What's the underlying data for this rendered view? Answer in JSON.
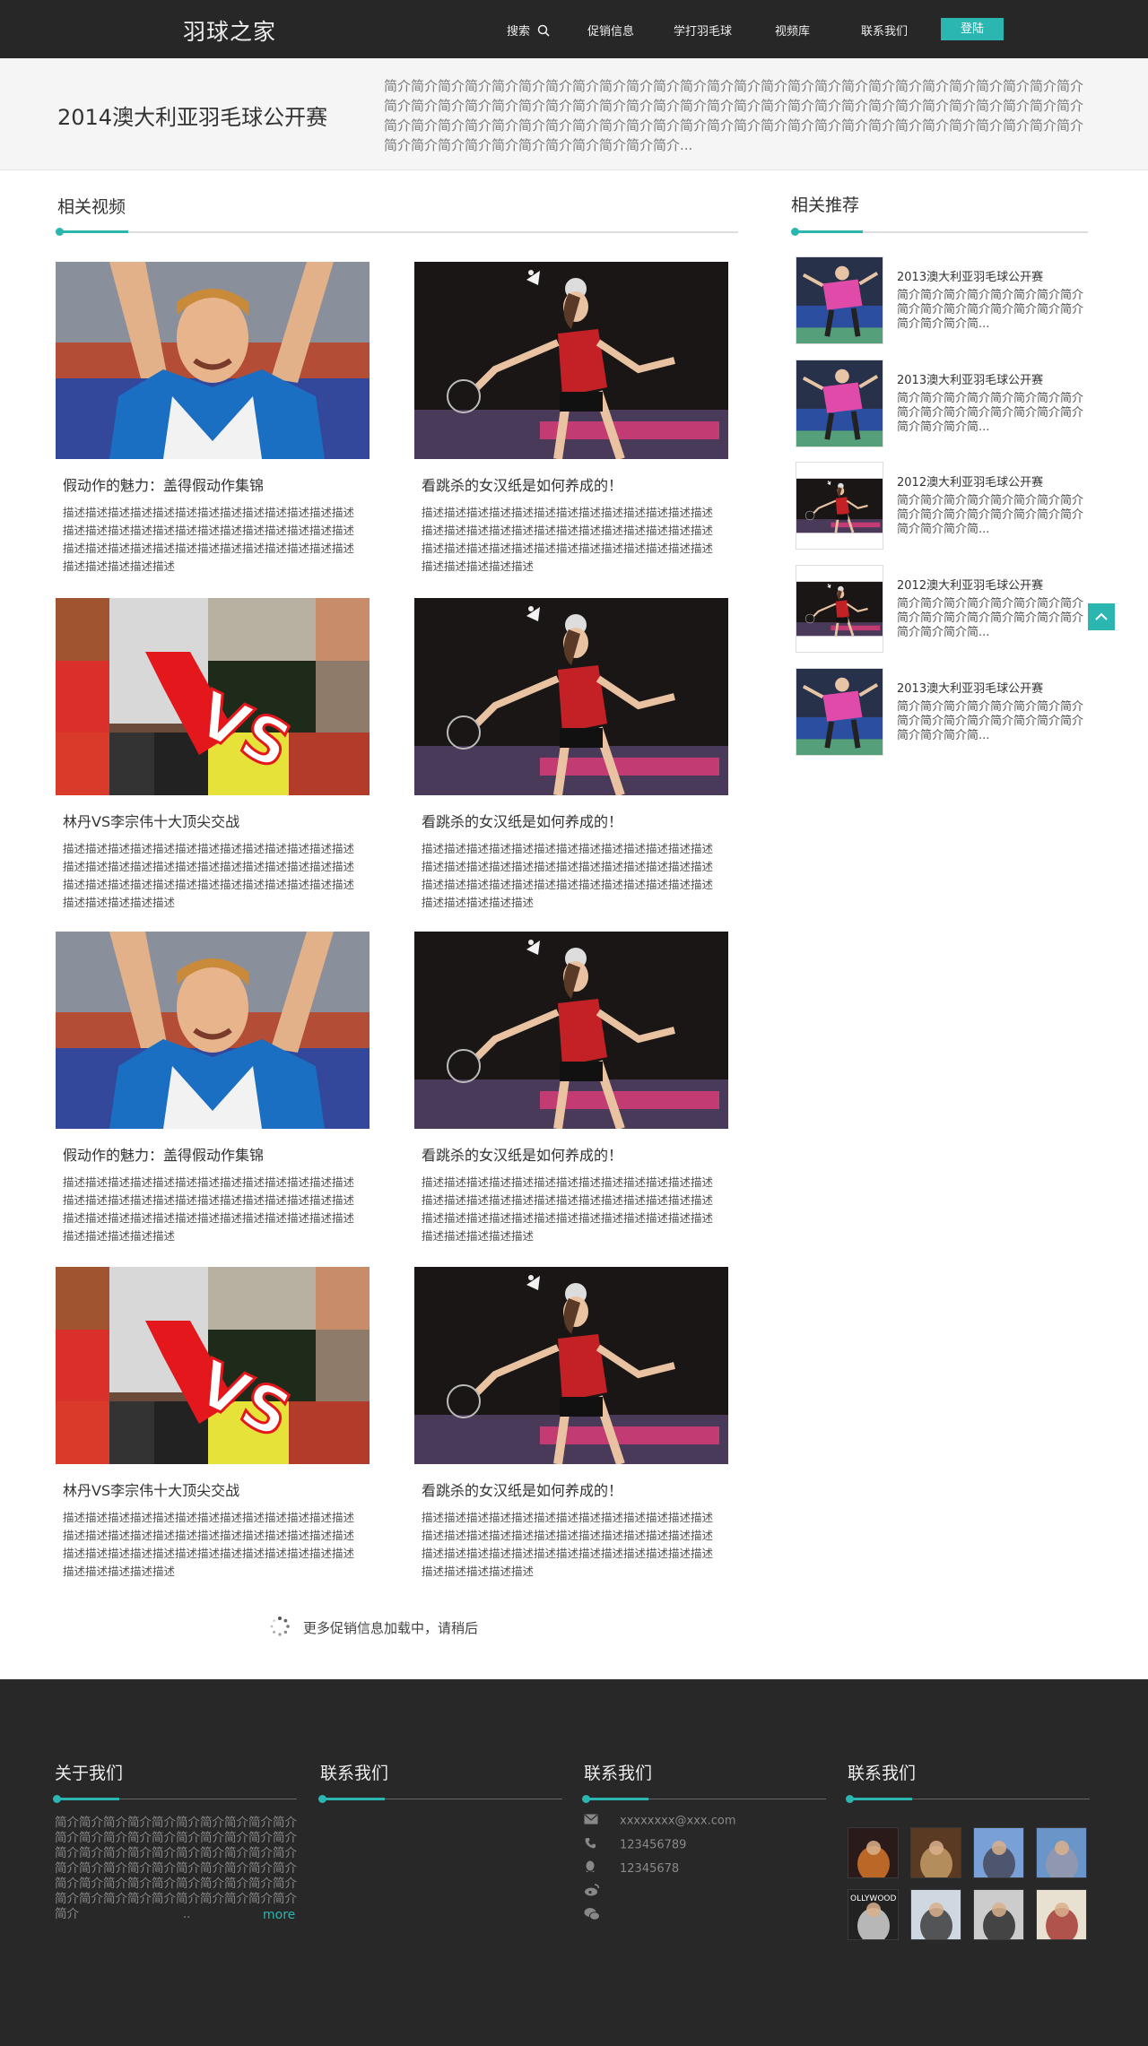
{
  "header": {
    "logo": "羽球之家",
    "nav": {
      "search": "搜索",
      "promo": "促销信息",
      "learn": "学打羽毛球",
      "videos": "视频库",
      "contact": "联系我们"
    },
    "login": "登陆"
  },
  "banner": {
    "title": "2014澳大利亚羽毛球公开赛",
    "description": "简介简介简介简介简介简介简介简介简介简介简介简介简介简介简介简介简介简介简介简介简介简介简介简介简介简介简介简介简介简介简介简介简介简介简介简介简介简介简介简介简介简介简介简介简介简介简介简介简介简介简介简介简介简介简介简介简介简介简介简介简介简介简介简介简介简介简介简介简介简介简介简介简介简介简介简介简介简介简介简介简介简介简介简介简介简介简介简介简介..."
  },
  "main": {
    "section_title": "相关视频",
    "videos": [
      {
        "title": "假动作的魅力：盖得假动作集锦",
        "desc": "描述描述描述描述描述描述描述描述描述描述描述描述描述描述描述描述描述描述描述描述描述描述描述描述描述描述描述描述描述描述描述描述描述描述描述描述描述描述描述描述描述描述描述描述",
        "image": "player-celebrating"
      },
      {
        "title": "看跳杀的女汉纸是如何养成的！",
        "desc": "描述描述描述描述描述描述描述描述描述描述描述描述描述描述描述描述描述描述描述描述描述描述描述描述描述描述描述描述描述描述描述描述描述描述描述描述描述描述描述描述描述描述描述描述",
        "image": "jump-smash"
      },
      {
        "title": "林丹VS李宗伟十大顶尖交战",
        "desc": "描述描述描述描述描述描述描述描述描述描述描述描述描述描述描述描述描述描述描述描述描述描述描述描述描述描述描述描述描述描述描述描述描述描述描述描述描述描述描述描述描述描述描述描述",
        "image": "lin-vs-lee"
      },
      {
        "title": "看跳杀的女汉纸是如何养成的！",
        "desc": "描述描述描述描述描述描述描述描述描述描述描述描述描述描述描述描述描述描述描述描述描述描述描述描述描述描述描述描述描述描述描述描述描述描述描述描述描述描述描述描述描述描述描述描述",
        "image": "jump-smash"
      },
      {
        "title": "假动作的魅力：盖得假动作集锦",
        "desc": "描述描述描述描述描述描述描述描述描述描述描述描述描述描述描述描述描述描述描述描述描述描述描述描述描述描述描述描述描述描述描述描述描述描述描述描述描述描述描述描述描述描述描述描述",
        "image": "player-celebrating"
      },
      {
        "title": "看跳杀的女汉纸是如何养成的！",
        "desc": "描述描述描述描述描述描述描述描述描述描述描述描述描述描述描述描述描述描述描述描述描述描述描述描述描述描述描述描述描述描述描述描述描述描述描述描述描述描述描述描述描述描述描述描述",
        "image": "jump-smash"
      },
      {
        "title": "林丹VS李宗伟十大顶尖交战",
        "desc": "描述描述描述描述描述描述描述描述描述描述描述描述描述描述描述描述描述描述描述描述描述描述描述描述描述描述描述描述描述描述描述描述描述描述描述描述描述描述描述描述描述描述描述描述",
        "image": "lin-vs-lee"
      },
      {
        "title": "看跳杀的女汉纸是如何养成的！",
        "desc": "描述描述描述描述描述描述描述描述描述描述描述描述描述描述描述描述描述描述描述描述描述描述描述描述描述描述描述描述描述描述描述描述描述描述描述描述描述描述描述描述描述描述描述描述",
        "image": "jump-smash"
      }
    ],
    "loading_text": "更多促销信息加载中，请稍后"
  },
  "sidebar": {
    "section_title": "相关推荐",
    "items": [
      {
        "title": "2013澳大利亚羽毛球公开赛",
        "desc": "简介简介简介简介简介简介简介简介简介简介简介简介简介简介简介简介简介简介简介简...",
        "image": "player-pink"
      },
      {
        "title": "2013澳大利亚羽毛球公开赛",
        "desc": "简介简介简介简介简介简介简介简介简介简介简介简介简介简介简介简介简介简介简介简...",
        "image": "player-pink"
      },
      {
        "title": "2012澳大利亚羽毛球公开赛",
        "desc": "简介简介简介简介简介简介简介简介简介简介简介简介简介简介简介简介简介简介简介简...",
        "image": "jump-smash"
      },
      {
        "title": "2012澳大利亚羽毛球公开赛",
        "desc": "简介简介简介简介简介简介简介简介简介简介简介简介简介简介简介简介简介简介简介简...",
        "image": "jump-smash"
      },
      {
        "title": "2013澳大利亚羽毛球公开赛",
        "desc": "简介简介简介简介简介简介简介简介简介简介简介简介简介简介简介简介简介简介简介简...",
        "image": "player-pink"
      }
    ]
  },
  "footer": {
    "about_title": "关于我们",
    "about_text": "简介简介简介简介简介简介简介简介简介简介简介简介简介简介简介简介简介简介简介简介简介简介简介简介简介简介简介简介简介简介简介简介简介简介简介简介简介简介简介简介简介简介简介简介简介简介简介简介简介简介简介简介简介简介简介简介简介简介简介简介简介",
    "about_ellipsis": "..",
    "more": "more",
    "col2_title": "联系我们",
    "col3_title": "联系我们",
    "col4_title": "联系我们",
    "email": "xxxxxxxx@xxx.com",
    "phone": "123456789",
    "qq": "12345678",
    "gallery_captions": [
      "",
      "",
      "",
      "",
      "OLLYWOOD",
      "",
      "",
      ""
    ]
  },
  "colors": {
    "accent": "#2bb6b1",
    "header_bg": "#272727",
    "footer_bg": "#282828"
  }
}
